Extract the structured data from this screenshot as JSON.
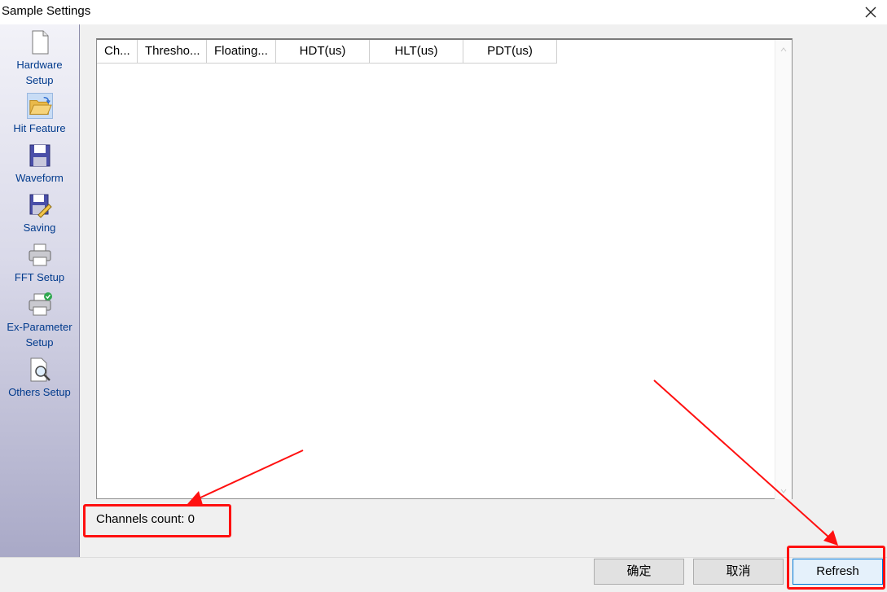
{
  "window": {
    "title": "Sample Settings"
  },
  "sidebar": {
    "items": [
      {
        "label": "Hardware\nSetup",
        "icon": "document-icon"
      },
      {
        "label": "Hit Feature",
        "icon": "folder-open-icon",
        "active": true
      },
      {
        "label": "Waveform",
        "icon": "floppy-disk-icon"
      },
      {
        "label": "Saving",
        "icon": "save-edit-icon"
      },
      {
        "label": "FFT Setup",
        "icon": "printer-icon"
      },
      {
        "label": "Ex-Parameter\nSetup",
        "icon": "printer-check-icon"
      },
      {
        "label": "Others Setup",
        "icon": "document-search-icon"
      }
    ]
  },
  "table": {
    "columns": [
      "Ch...",
      "Thresho...",
      "Floating...",
      "HDT(us)",
      "HLT(us)",
      "PDT(us)"
    ],
    "rows": []
  },
  "status": {
    "channels_count": "Channels count: 0"
  },
  "buttons": {
    "ok": "确定",
    "cancel": "取消",
    "refresh": "Refresh"
  },
  "colors": {
    "annotation": "#ff1010",
    "sidebar_text": "#003a8c"
  }
}
